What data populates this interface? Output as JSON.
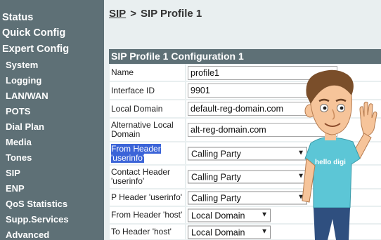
{
  "sidebar": {
    "items": [
      {
        "label": "Status"
      },
      {
        "label": "Quick Config"
      },
      {
        "label": "Expert Config"
      },
      {
        "label": "System"
      },
      {
        "label": "Logging"
      },
      {
        "label": "LAN/WAN"
      },
      {
        "label": "POTS"
      },
      {
        "label": "Dial Plan"
      },
      {
        "label": "Media"
      },
      {
        "label": "Tones"
      },
      {
        "label": "SIP"
      },
      {
        "label": "ENP"
      },
      {
        "label": "QoS Statistics"
      },
      {
        "label": "Supp.Services"
      },
      {
        "label": "Advanced"
      }
    ]
  },
  "breadcrumb": {
    "link": "SIP",
    "separator": ">",
    "current": "SIP Profile 1"
  },
  "panel": {
    "title": "SIP Profile 1 Configuration 1"
  },
  "form": {
    "rows": [
      {
        "label": "Name",
        "value": "profile1"
      },
      {
        "label": "Interface ID",
        "value": "9901"
      },
      {
        "label": "Local Domain",
        "value": "default-reg-domain.com"
      },
      {
        "label": "Alternative Local Domain",
        "value": "alt-reg-domain.com"
      },
      {
        "label": "From Header 'userinfo'",
        "value": "Calling Party"
      },
      {
        "label": "Contact Header 'userinfo'",
        "value": "Calling Party"
      },
      {
        "label": "P Header 'userinfo'",
        "value": "Calling Party"
      },
      {
        "label": "From Header 'host'",
        "value": "Local Domain"
      },
      {
        "label": "To Header 'host'",
        "value": "Local Domain"
      }
    ]
  },
  "mascot": {
    "shirt_text": "hello digi"
  },
  "colors": {
    "sidebar": "#5e7076",
    "panel_header": "#5e7076",
    "content_bg": "#e9eff0",
    "highlight": "#3b64d8"
  }
}
